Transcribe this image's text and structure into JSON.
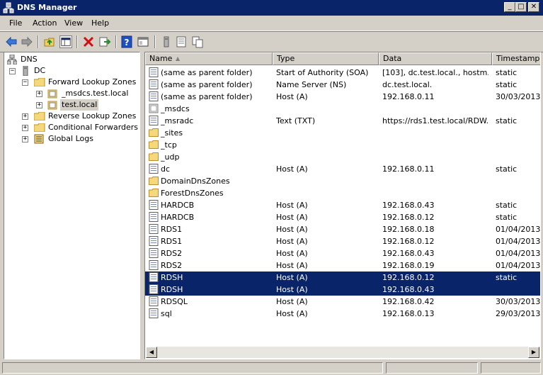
{
  "window": {
    "title": "DNS Manager"
  },
  "menu": [
    "File",
    "Action",
    "View",
    "Help"
  ],
  "toolbar": {
    "buttons": [
      "back-arrow-icon",
      "forward-arrow-icon",
      "up-folder-icon",
      "show-hide-tree-icon",
      "delete-icon",
      "export-list-icon",
      "help-icon",
      "properties-icon",
      "server-icon",
      "records-icon",
      "copy-icon"
    ]
  },
  "tree": {
    "root": "DNS",
    "server": "DC",
    "forward_zones": "Forward Lookup Zones",
    "zone1": "_msdcs.test.local",
    "zone2": "test.local",
    "reverse_zones": "Reverse Lookup Zones",
    "conditional": "Conditional Forwarders",
    "global_logs": "Global Logs"
  },
  "columns": [
    "Name",
    "Type",
    "Data",
    "Timestamp"
  ],
  "rows": [
    {
      "name": "(same as parent folder)",
      "type": "Start of Authority (SOA)",
      "data": "[103], dc.test.local., hostm...",
      "ts": "static",
      "icon": "record"
    },
    {
      "name": "(same as parent folder)",
      "type": "Name Server (NS)",
      "data": "dc.test.local.",
      "ts": "static",
      "icon": "record"
    },
    {
      "name": "(same as parent folder)",
      "type": "Host (A)",
      "data": "192.168.0.11",
      "ts": "30/03/2013 (",
      "icon": "record"
    },
    {
      "name": "_msdcs",
      "type": "",
      "data": "",
      "ts": "",
      "icon": "delegation"
    },
    {
      "name": "_msradc",
      "type": "Text (TXT)",
      "data": "https://rds1.test.local/RDW...",
      "ts": "static",
      "icon": "record"
    },
    {
      "name": "_sites",
      "type": "",
      "data": "",
      "ts": "",
      "icon": "folder"
    },
    {
      "name": "_tcp",
      "type": "",
      "data": "",
      "ts": "",
      "icon": "folder"
    },
    {
      "name": "_udp",
      "type": "",
      "data": "",
      "ts": "",
      "icon": "folder"
    },
    {
      "name": "dc",
      "type": "Host (A)",
      "data": "192.168.0.11",
      "ts": "static",
      "icon": "record"
    },
    {
      "name": "DomainDnsZones",
      "type": "",
      "data": "",
      "ts": "",
      "icon": "folder"
    },
    {
      "name": "ForestDnsZones",
      "type": "",
      "data": "",
      "ts": "",
      "icon": "folder"
    },
    {
      "name": "HARDCB",
      "type": "Host (A)",
      "data": "192.168.0.43",
      "ts": "static",
      "icon": "record"
    },
    {
      "name": "HARDCB",
      "type": "Host (A)",
      "data": "192.168.0.12",
      "ts": "static",
      "icon": "record"
    },
    {
      "name": "RDS1",
      "type": "Host (A)",
      "data": "192.168.0.18",
      "ts": "01/04/2013 1",
      "icon": "record"
    },
    {
      "name": "RDS1",
      "type": "Host (A)",
      "data": "192.168.0.12",
      "ts": "01/04/2013 1",
      "icon": "record"
    },
    {
      "name": "RDS2",
      "type": "Host (A)",
      "data": "192.168.0.43",
      "ts": "01/04/2013 1",
      "icon": "record"
    },
    {
      "name": "RDS2",
      "type": "Host (A)",
      "data": "192.168.0.19",
      "ts": "01/04/2013 1",
      "icon": "record"
    },
    {
      "name": "RDSH",
      "type": "Host (A)",
      "data": "192.168.0.12",
      "ts": "static",
      "icon": "record",
      "selected": true
    },
    {
      "name": "RDSH",
      "type": "Host (A)",
      "data": "192.168.0.43",
      "ts": "",
      "icon": "record",
      "selected": true
    },
    {
      "name": "RDSQL",
      "type": "Host (A)",
      "data": "192.168.0.42",
      "ts": "30/03/2013 1",
      "icon": "record"
    },
    {
      "name": "sql",
      "type": "Host (A)",
      "data": "192.168.0.13",
      "ts": "29/03/2013 1",
      "icon": "record"
    }
  ],
  "colors": {
    "selection": "#0a246a",
    "title_bar": "#0a246a",
    "chrome": "#d4d0c8"
  }
}
